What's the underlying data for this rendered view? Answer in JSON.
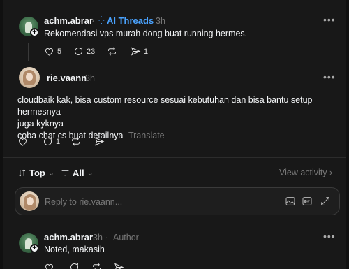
{
  "post": {
    "username": "achm.abrar",
    "community": "AI Threads",
    "time": "3h",
    "text": "Rekomendasi vps murah dong buat running hermes.",
    "likes": "5",
    "comments": "23",
    "shares": "1"
  },
  "reply1": {
    "username": "rie.vaann",
    "time": "3h",
    "text_line1": "cloudbaik kak, bisa custom resource sesuai kebutuhan dan bisa bantu setup hermesnya",
    "text_line2": "juga kyknya",
    "text_line3": "coba chat cs buat detailnya",
    "translate": "Translate",
    "comments": "1"
  },
  "filters": {
    "sort": "Top",
    "scope": "All",
    "view_activity": "View activity"
  },
  "reply_box": {
    "placeholder": "Reply to rie.vaann..."
  },
  "reply2": {
    "username": "achm.abrar",
    "time": "3h",
    "author_tag": "Author",
    "text": "Noted, makasih"
  }
}
